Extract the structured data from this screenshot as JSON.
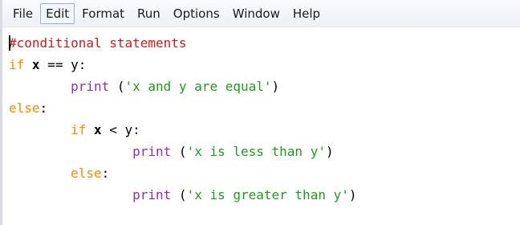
{
  "menubar": {
    "items": [
      {
        "label": "File"
      },
      {
        "label": "Edit"
      },
      {
        "label": "Format"
      },
      {
        "label": "Run"
      },
      {
        "label": "Options"
      },
      {
        "label": "Window"
      },
      {
        "label": "Help"
      }
    ],
    "active_item": "Edit"
  },
  "editor": {
    "lines": [
      [
        {
          "text": "#conditional statements",
          "type": "comment"
        }
      ],
      [
        {
          "text": "if",
          "type": "keyword"
        },
        {
          "text": " ",
          "type": "plain"
        },
        {
          "text": "x",
          "type": "plain-bold"
        },
        {
          "text": " == ",
          "type": "plain"
        },
        {
          "text": "y",
          "type": "plain"
        },
        {
          "text": ":",
          "type": "plain"
        }
      ],
      [
        {
          "text": "        ",
          "type": "plain"
        },
        {
          "text": "print",
          "type": "builtin"
        },
        {
          "text": " (",
          "type": "plain"
        },
        {
          "text": "'x and y are equal'",
          "type": "string"
        },
        {
          "text": ")",
          "type": "plain"
        }
      ],
      [
        {
          "text": "else",
          "type": "keyword"
        },
        {
          "text": ":",
          "type": "plain"
        }
      ],
      [
        {
          "text": "        ",
          "type": "plain"
        },
        {
          "text": "if",
          "type": "keyword"
        },
        {
          "text": " ",
          "type": "plain"
        },
        {
          "text": "x",
          "type": "plain-bold"
        },
        {
          "text": " < ",
          "type": "plain"
        },
        {
          "text": "y",
          "type": "plain"
        },
        {
          "text": ":",
          "type": "plain"
        }
      ],
      [
        {
          "text": "                ",
          "type": "plain"
        },
        {
          "text": "print",
          "type": "builtin"
        },
        {
          "text": " (",
          "type": "plain"
        },
        {
          "text": "'x is less than y'",
          "type": "string"
        },
        {
          "text": ")",
          "type": "plain"
        }
      ],
      [
        {
          "text": "        ",
          "type": "plain"
        },
        {
          "text": "else",
          "type": "keyword"
        },
        {
          "text": ":",
          "type": "plain"
        }
      ],
      [
        {
          "text": "                ",
          "type": "plain"
        },
        {
          "text": "print",
          "type": "builtin"
        },
        {
          "text": " (",
          "type": "plain"
        },
        {
          "text": "'x is greater than y'",
          "type": "string"
        },
        {
          "text": ")",
          "type": "plain"
        }
      ]
    ],
    "cursor": {
      "line": 1,
      "column": 1
    }
  },
  "colors": {
    "comment": "#d01818",
    "keyword": "#ff8800",
    "string": "#1a9e1a",
    "builtin": "#8b2fbe",
    "plain": "#000000"
  }
}
